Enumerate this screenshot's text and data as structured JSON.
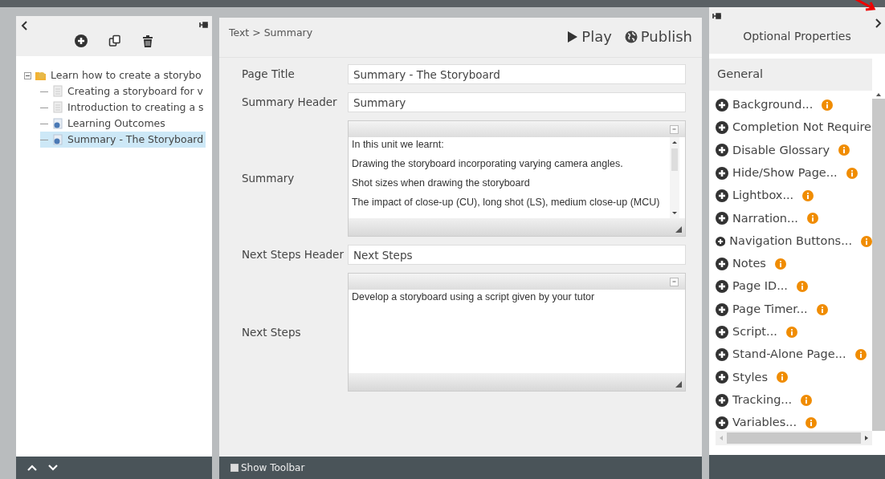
{
  "tree_panel": {
    "tools": [
      {
        "kind": "add"
      },
      {
        "kind": "copy"
      },
      {
        "kind": "delete"
      }
    ],
    "tree": [
      {
        "label": "Learn how to create a storybo",
        "kind": "folder",
        "expanded": true,
        "selected": false,
        "children": [
          {
            "label": "Creating a storyboard for v",
            "kind": "page",
            "selected": false
          },
          {
            "label": "Introduction to creating a s",
            "kind": "page",
            "selected": false
          },
          {
            "label": "Learning Outcomes",
            "kind": "info",
            "selected": false
          },
          {
            "label": "Summary - The Storyboard",
            "kind": "info",
            "selected": true
          }
        ]
      }
    ]
  },
  "editor": {
    "breadcrumb": "Text > Summary",
    "actions": [
      {
        "label": "Play",
        "kind": "play"
      },
      {
        "label": "Publish",
        "kind": "globe"
      }
    ],
    "fields": [
      {
        "label": "Page Title",
        "kind": "input",
        "value": "Summary - The Storyboard"
      },
      {
        "label": "Summary Header",
        "kind": "input",
        "value": "Summary"
      },
      {
        "label": "Summary",
        "kind": "rich",
        "lines": [
          "In this unit we learnt:",
          "Drawing the storyboard incorporating varying camera angles.",
          "Shot sizes when drawing the storyboard",
          "The impact of close-up (CU), long shot (LS), medium close-up (MCU)"
        ]
      },
      {
        "label": "Next Steps Header",
        "kind": "input",
        "value": "Next Steps"
      },
      {
        "label": "Next Steps",
        "kind": "rich",
        "lines": [
          "Develop a storyboard using a script given by your tutor"
        ]
      }
    ],
    "show_toolbar": {
      "label": "Show Toolbar",
      "checked": false
    }
  },
  "properties": {
    "title": "Optional Properties",
    "section": "General",
    "items": [
      {
        "label": "Background...",
        "info": true
      },
      {
        "label": "Completion Not Require",
        "info": false
      },
      {
        "label": "Disable Glossary",
        "info": true
      },
      {
        "label": "Hide/Show Page...",
        "info": true
      },
      {
        "label": "Lightbox...",
        "info": true
      },
      {
        "label": "Narration...",
        "info": true
      },
      {
        "label": "Navigation Buttons...",
        "info": true
      },
      {
        "label": "Notes",
        "info": true
      },
      {
        "label": "Page ID...",
        "info": true
      },
      {
        "label": "Page Timer...",
        "info": true
      },
      {
        "label": "Script...",
        "info": true
      },
      {
        "label": "Stand-Alone Page...",
        "info": true
      },
      {
        "label": "Styles",
        "info": true
      },
      {
        "label": "Tracking...",
        "info": true
      },
      {
        "label": "Variables...",
        "info": true
      }
    ]
  }
}
